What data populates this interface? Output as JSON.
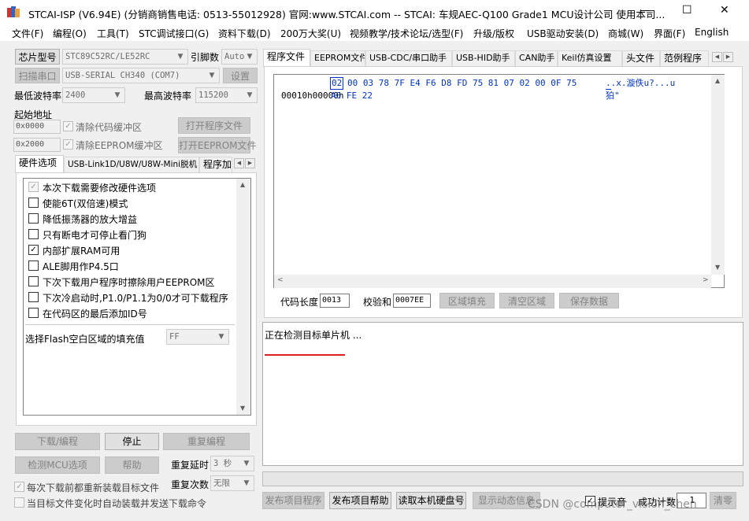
{
  "window": {
    "title": "STCAI-ISP (V6.94E) (分销商销售电话: 0513-55012928) 官网:www.STCAI.com  -- STCAI: 车规AEC-Q100 Grade1 MCU设计公司 使用本司...",
    "minimize": "—",
    "maximize": "☐",
    "close": "✕"
  },
  "menu": [
    "文件(F)",
    "编程(O)",
    "工具(T)",
    "STC调试接口(G)",
    "资料下载(D)",
    "200万大奖(U)",
    "视频教学/技术论坛/选型(F)",
    "升级/版权",
    "USB驱动安装(D)",
    "商城(W)",
    "界面(F)",
    "English"
  ],
  "left": {
    "chip_button": "芯片型号",
    "chip_value": "STC89C52RC/LE52RC",
    "pin_label": "引脚数",
    "pin_value": "Auto",
    "scan_button": "扫描串口",
    "port_value": "USB-SERIAL CH340 (COM7)",
    "settings_button": "设置",
    "min_baud_label": "最低波特率",
    "min_baud_value": "2400",
    "max_baud_label": "最高波特率",
    "max_baud_value": "115200",
    "start_addr_label": "起始地址",
    "addr1": "0x0000",
    "clear_code_label": "清除代码缓冲区",
    "open_prog_button": "打开程序文件",
    "addr2": "0x2000",
    "clear_eeprom_label": "清除EEPROM缓冲区",
    "open_eeprom_button": "打开EEPROM文件",
    "tabs": [
      "硬件选项",
      "USB-Link1D/U8W/U8W-Mini脱机",
      "程序加"
    ],
    "options": [
      {
        "label": "本次下载需要修改硬件选项",
        "checked": "✓"
      },
      {
        "label": "使能6T(双倍速)模式",
        "checked": ""
      },
      {
        "label": "降低振荡器的放大增益",
        "checked": ""
      },
      {
        "label": "只有断电才可停止看门狗",
        "checked": ""
      },
      {
        "label": "内部扩展RAM可用",
        "checked": "✓"
      },
      {
        "label": "ALE脚用作P4.5口",
        "checked": ""
      },
      {
        "label": "下次下载用户程序时擦除用户EEPROM区",
        "checked": ""
      },
      {
        "label": "下次冷启动时,P1.0/P1.1为0/0才可下载程序",
        "checked": ""
      },
      {
        "label": "在代码区的最后添加ID号",
        "checked": ""
      }
    ],
    "fill_label": "选择Flash空白区域的填充值",
    "fill_value": "FF",
    "download_button": "下载/编程",
    "stop_button": "停止",
    "reprogram_button": "重复编程",
    "detect_button": "检测MCU选项",
    "help_button": "帮助",
    "repeat_delay_label": "重复延时",
    "repeat_delay_value": "3 秒",
    "repeat_count_label": "重复次数",
    "repeat_count_value": "无限",
    "reload_label": "每次下载前都重新装载目标文件",
    "autoload_label": "当目标文件变化时自动装载并发送下载命令"
  },
  "right": {
    "tabs": [
      "程序文件",
      "EEPROM文件",
      "USB-CDC/串口助手",
      "USB-HID助手",
      "CAN助手",
      "Keil仿真设置",
      "头文件",
      "范例程序"
    ],
    "hex_rows": [
      {
        "addr": "00000h",
        "first": "02",
        "bytes": "00 03 78 7F E4 F6 D8 FD 75 81 07 02 00 0F 75",
        "ascii": "..x.漩佚u?...u"
      },
      {
        "addr": "00010h",
        "first": "",
        "bytes": "A0 FE 22",
        "ascii": "狛\""
      }
    ],
    "code_len_label": "代码长度",
    "code_len_value": "0013",
    "checksum_label": "校验和",
    "checksum_value": "0007EE",
    "fill_region_button": "区域填充",
    "clear_region_button": "清空区域",
    "save_data_button": "保存数据",
    "status_text": "正在检测目标单片机 ...",
    "publish_prog_button": "发布项目程序",
    "publish_help_button": "发布项目帮助",
    "read_disk_button": "读取本机硬盘号",
    "show_info_button": "显示动态信息",
    "sound_label": "提示音",
    "success_count_label": "成功计数",
    "success_count_value": "1",
    "clear_button": "清零",
    "watermark": "CSDN @computer_vision_chen"
  },
  "colors": {
    "accent_red": "#e02020",
    "hex_select": "#0033cc"
  }
}
